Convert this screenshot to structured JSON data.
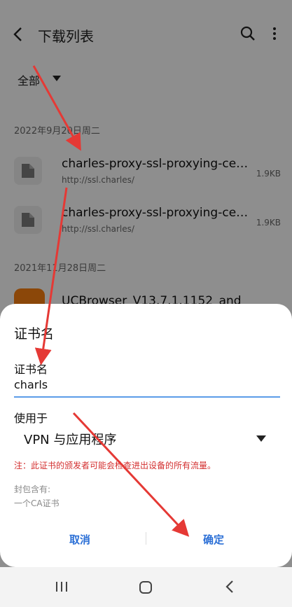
{
  "appbar": {
    "title": "下载列表",
    "back_icon": "arrow-left-icon",
    "search_icon": "search-icon",
    "more_icon": "more-vert-icon"
  },
  "filter": {
    "label": "全部"
  },
  "groups": [
    {
      "date": "2022年9月20日周二",
      "items": [
        {
          "name": "charles-proxy-ssl-proxying-certificate.pem",
          "url": "http://ssl.charles/",
          "size": "1.9KB"
        },
        {
          "name": "charles-proxy-ssl-proxying-certificate.pem",
          "url": "http://ssl.charles/",
          "size": "1.9KB"
        }
      ]
    },
    {
      "date": "2021年11月28日周二",
      "items": [
        {
          "name": "UCBrowser_V13.7.1.1152_and",
          "url": "",
          "size": ""
        }
      ]
    }
  ],
  "dialog": {
    "title": "证书名",
    "name_label": "证书名",
    "name_value": "charls",
    "use_label": "使用于",
    "use_value": "VPN 与应用程序",
    "warning": "注：此证书的颁发者可能会检查进出设备的所有流量。",
    "contains_label": "封包含有:",
    "contains_value": "一个CA证书",
    "cancel": "取消",
    "confirm": "确定"
  },
  "colors": {
    "accent": "#2b6fd6",
    "warning": "#d32f2f",
    "arrow": "#e53935",
    "underline": "#5b9ce8"
  }
}
